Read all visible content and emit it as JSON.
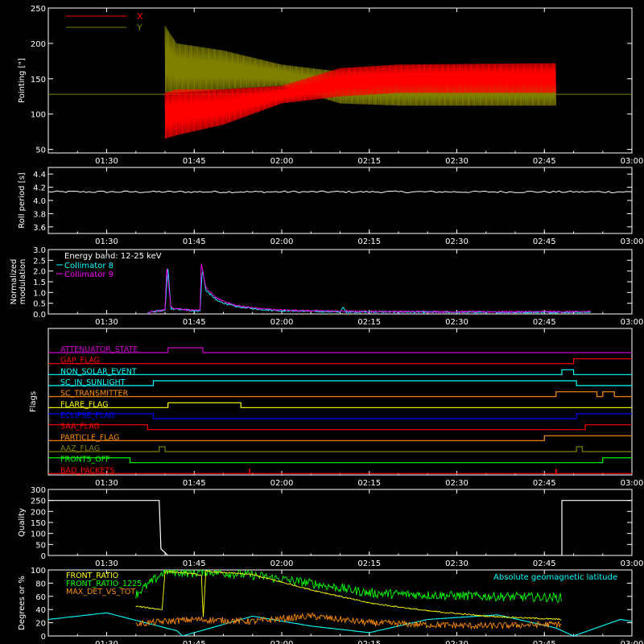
{
  "colors": {
    "background": "#000000",
    "axis": "#ffffff",
    "red": "#ff0000",
    "olive": "#808000",
    "cyan": "#00ffff",
    "magenta": "#ff00ff",
    "yellow": "#ffff00",
    "green": "#00ff00",
    "orange": "#ff8c00",
    "blue": "#0000ff",
    "purple": "#cc00cc",
    "ltblue": "#40c0ff"
  },
  "time_axis": {
    "range": [
      "01:20",
      "03:00"
    ],
    "tick_labels": [
      "01:30",
      "01:45",
      "02:00",
      "02:15",
      "02:30",
      "02:45",
      "03:00"
    ]
  },
  "chart_data": [
    {
      "id": "pointing",
      "type": "line",
      "ylabel": "Pointing [\"]",
      "ylim": [
        45,
        250
      ],
      "y_ticks": [
        50,
        100,
        150,
        200,
        250
      ],
      "legend": {
        "placement": "top-left"
      },
      "series": [
        {
          "name": "X",
          "color": "red",
          "start": "01:40",
          "end": "02:47",
          "baseline": 128,
          "envelope": [
            {
              "t": "01:40",
              "lo": 65,
              "hi": 130
            },
            {
              "t": "01:42",
              "lo": 70,
              "hi": 135
            },
            {
              "t": "01:50",
              "lo": 85,
              "hi": 135
            },
            {
              "t": "02:00",
              "lo": 115,
              "hi": 140
            },
            {
              "t": "02:10",
              "lo": 125,
              "hi": 165
            },
            {
              "t": "02:20",
              "lo": 130,
              "hi": 170
            },
            {
              "t": "02:47",
              "lo": 130,
              "hi": 172
            }
          ]
        },
        {
          "name": "Y",
          "color": "olive",
          "start": "01:40",
          "end": "02:47",
          "baseline": 128,
          "envelope": [
            {
              "t": "01:40",
              "lo": 130,
              "hi": 225
            },
            {
              "t": "01:42",
              "lo": 130,
              "hi": 200
            },
            {
              "t": "01:50",
              "lo": 135,
              "hi": 190
            },
            {
              "t": "02:00",
              "lo": 140,
              "hi": 170
            },
            {
              "t": "02:10",
              "lo": 115,
              "hi": 160
            },
            {
              "t": "02:20",
              "lo": 112,
              "hi": 158
            },
            {
              "t": "02:47",
              "lo": 112,
              "hi": 158
            }
          ]
        }
      ]
    },
    {
      "id": "roll",
      "type": "line",
      "ylabel": "Roll period [s]",
      "ylim": [
        3.5,
        4.5
      ],
      "y_ticks": [
        3.6,
        3.8,
        4.0,
        4.2,
        4.4
      ],
      "series": [
        {
          "color": "axis",
          "start": "01:20",
          "end": "03:00",
          "value": 4.13
        }
      ]
    },
    {
      "id": "modulation",
      "type": "line",
      "ylabel_lines": [
        "Normalized",
        "modulation"
      ],
      "ylim": [
        0,
        3.0
      ],
      "y_ticks": [
        0.0,
        0.5,
        1.0,
        1.5,
        2.0,
        2.5,
        3.0
      ],
      "legend": {
        "placement": "top-left",
        "title": "Energy band: 12-25 keV"
      },
      "series": [
        {
          "name": "Collimator 8",
          "color": "cyan",
          "start": "01:37",
          "end": "02:53",
          "points": [
            {
              "t": "01:37",
              "v": 0.05
            },
            {
              "t": "01:39",
              "v": 0.15
            },
            {
              "t": "01:40",
              "v": 0.15
            },
            {
              "t": "01:40.5",
              "v": 2.2
            },
            {
              "t": "01:41",
              "v": 0.25
            },
            {
              "t": "01:45",
              "v": 0.15
            },
            {
              "t": "01:46",
              "v": 0.15
            },
            {
              "t": "01:46.4",
              "v": 2.1
            },
            {
              "t": "01:47",
              "v": 1.1
            },
            {
              "t": "01:49",
              "v": 0.6
            },
            {
              "t": "01:52",
              "v": 0.35
            },
            {
              "t": "01:56",
              "v": 0.22
            },
            {
              "t": "02:00",
              "v": 0.15
            },
            {
              "t": "02:10",
              "v": 0.1
            },
            {
              "t": "02:10.5",
              "v": 0.3
            },
            {
              "t": "02:11",
              "v": 0.1
            },
            {
              "t": "02:30",
              "v": 0.08
            },
            {
              "t": "02:53",
              "v": 0.08
            }
          ]
        },
        {
          "name": "Collimator 9",
          "color": "magenta",
          "start": "01:37",
          "end": "02:53",
          "points": [
            {
              "t": "01:37",
              "v": 0.05
            },
            {
              "t": "01:39",
              "v": 0.15
            },
            {
              "t": "01:40",
              "v": 0.2
            },
            {
              "t": "01:40.3",
              "v": 2.3
            },
            {
              "t": "01:41",
              "v": 0.3
            },
            {
              "t": "01:45",
              "v": 0.15
            },
            {
              "t": "01:46",
              "v": 0.2
            },
            {
              "t": "01:46.2",
              "v": 2.4
            },
            {
              "t": "01:47",
              "v": 1.2
            },
            {
              "t": "01:49",
              "v": 0.7
            },
            {
              "t": "01:52",
              "v": 0.4
            },
            {
              "t": "01:56",
              "v": 0.25
            },
            {
              "t": "02:00",
              "v": 0.18
            },
            {
              "t": "02:10",
              "v": 0.12
            },
            {
              "t": "02:30",
              "v": 0.1
            },
            {
              "t": "02:53",
              "v": 0.1
            }
          ]
        }
      ]
    },
    {
      "id": "flags",
      "type": "line",
      "ylabel": "Flags",
      "rows": [
        {
          "name": "ATTENUATOR_STATE",
          "color": "purple",
          "steps": [
            [
              "01:20",
              0
            ],
            [
              "01:40.5",
              1
            ],
            [
              "01:46.5",
              0
            ]
          ]
        },
        {
          "name": "GAP_FLAG",
          "color": "red",
          "steps": [
            [
              "01:20",
              0
            ],
            [
              "02:50",
              1
            ]
          ]
        },
        {
          "name": "NON_SOLAR_EVENT",
          "color": "cyan",
          "steps": [
            [
              "01:20",
              0
            ],
            [
              "02:48",
              1
            ],
            [
              "02:50",
              0
            ]
          ]
        },
        {
          "name": "SC_IN_SUNLIGHT",
          "color": "cyan",
          "steps": [
            [
              "01:20",
              0
            ],
            [
              "01:38",
              1
            ],
            [
              "02:50.5",
              0
            ]
          ]
        },
        {
          "name": "SC_TRANSMITTER",
          "color": "orange",
          "steps": [
            [
              "01:20",
              0
            ],
            [
              "02:47",
              1
            ],
            [
              "02:54",
              0
            ],
            [
              "02:55",
              1
            ],
            [
              "02:57",
              0
            ]
          ]
        },
        {
          "name": "FLARE_FLAG",
          "color": "yellow",
          "steps": [
            [
              "01:20",
              0
            ],
            [
              "01:40.5",
              1
            ],
            [
              "01:53",
              0
            ]
          ]
        },
        {
          "name": "ECLIPSE_FLAG",
          "color": "blue",
          "steps": [
            [
              "01:20",
              1
            ],
            [
              "01:38",
              0
            ],
            [
              "02:50.5",
              1
            ]
          ]
        },
        {
          "name": "SAA_FLAG",
          "color": "red",
          "steps": [
            [
              "01:20",
              1
            ],
            [
              "01:37",
              0
            ],
            [
              "02:52",
              1
            ]
          ]
        },
        {
          "name": "PARTICLE_FLAG",
          "color": "orange",
          "steps": [
            [
              "01:20",
              0
            ],
            [
              "02:45",
              1
            ]
          ]
        },
        {
          "name": "AAZ_FLAG",
          "color": "olive",
          "steps": [
            [
              "01:20",
              0
            ],
            [
              "01:39",
              1
            ],
            [
              "01:40",
              0
            ],
            [
              "02:50.5",
              1
            ],
            [
              "02:51.5",
              0
            ]
          ]
        },
        {
          "name": "FRONTS_OFF",
          "color": "green",
          "steps": [
            [
              "01:20",
              1
            ],
            [
              "01:34",
              0
            ],
            [
              "02:55",
              1
            ]
          ]
        },
        {
          "name": "BAD_PACKETS",
          "color": "red",
          "steps": [
            [
              "01:20",
              0
            ]
          ],
          "spikes": [
            "01:54.5",
            "02:47"
          ]
        }
      ]
    },
    {
      "id": "quality",
      "type": "line",
      "ylabel": "Quality",
      "ylim": [
        0,
        300
      ],
      "y_ticks": [
        0,
        50,
        100,
        150,
        200,
        250,
        300
      ],
      "series": [
        {
          "color": "axis",
          "steps": [
            [
              "01:20",
              250
            ],
            [
              "01:39",
              250
            ],
            [
              "01:39.3",
              30
            ],
            [
              "01:40.5",
              0
            ],
            [
              "02:48",
              0
            ],
            [
              "02:48",
              250
            ],
            [
              "03:00",
              250
            ]
          ]
        }
      ]
    },
    {
      "id": "fronts",
      "type": "line",
      "ylabel": "Degrees or %",
      "ylim": [
        0,
        100
      ],
      "y_ticks": [
        0,
        20,
        40,
        60,
        80,
        100
      ],
      "legend": {
        "placement": "top-left"
      },
      "annotation": "Absolute geomagnetic latitude",
      "series": [
        {
          "name": "FRONT_RATIO",
          "color": "yellow",
          "points": [
            {
              "t": "01:35",
              "v": 45
            },
            {
              "t": "01:39.5",
              "v": 40
            },
            {
              "t": "01:40",
              "v": 98
            },
            {
              "t": "01:44",
              "v": 95
            },
            {
              "t": "01:46.3",
              "v": 92
            },
            {
              "t": "01:46.5",
              "v": 20
            },
            {
              "t": "01:47",
              "v": 98
            },
            {
              "t": "01:55",
              "v": 93
            },
            {
              "t": "02:05",
              "v": 70
            },
            {
              "t": "02:15",
              "v": 50
            },
            {
              "t": "02:25",
              "v": 38
            },
            {
              "t": "02:35",
              "v": 30
            },
            {
              "t": "02:48",
              "v": 25
            }
          ]
        },
        {
          "name": "FRONT_RATIO_1225",
          "color": "green",
          "baseline": 60,
          "points": [
            {
              "t": "01:35",
              "v": 63
            },
            {
              "t": "01:40",
              "v": 98
            },
            {
              "t": "01:45",
              "v": 95
            },
            {
              "t": "01:46.5",
              "v": 98
            },
            {
              "t": "01:55",
              "v": 92
            },
            {
              "t": "02:05",
              "v": 80
            },
            {
              "t": "02:15",
              "v": 65
            },
            {
              "t": "02:25",
              "v": 62
            },
            {
              "t": "02:35",
              "v": 60
            },
            {
              "t": "02:48",
              "v": 58
            }
          ]
        },
        {
          "name": "MAX_DET_VS_TOT",
          "color": "orange",
          "points": [
            {
              "t": "01:35",
              "v": 18
            },
            {
              "t": "01:40",
              "v": 22
            },
            {
              "t": "01:45",
              "v": 25
            },
            {
              "t": "01:55",
              "v": 22
            },
            {
              "t": "02:05",
              "v": 30
            },
            {
              "t": "02:15",
              "v": 20
            },
            {
              "t": "02:25",
              "v": 17
            },
            {
              "t": "02:35",
              "v": 15
            },
            {
              "t": "02:48",
              "v": 18
            }
          ]
        },
        {
          "name": "Absolute geomagnetic latitude",
          "color": "cyan",
          "points": [
            {
              "t": "01:20",
              "v": 25
            },
            {
              "t": "01:30",
              "v": 35
            },
            {
              "t": "01:42",
              "v": 8
            },
            {
              "t": "01:43",
              "v": 0
            },
            {
              "t": "01:55",
              "v": 30
            },
            {
              "t": "02:05",
              "v": 15
            },
            {
              "t": "02:15",
              "v": 5
            },
            {
              "t": "02:25",
              "v": 25
            },
            {
              "t": "02:37",
              "v": 32
            },
            {
              "t": "02:47",
              "v": 12
            },
            {
              "t": "02:50",
              "v": 0
            },
            {
              "t": "02:58",
              "v": 25
            },
            {
              "t": "03:00",
              "v": 22
            }
          ]
        }
      ]
    }
  ]
}
